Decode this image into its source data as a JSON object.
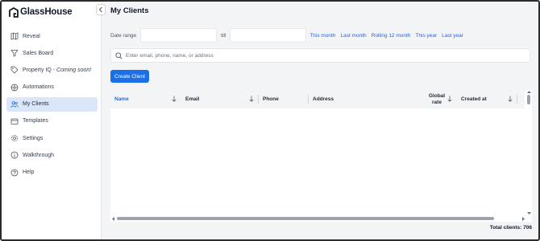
{
  "app": {
    "brand": "GlassHouse"
  },
  "sidebar": {
    "items": [
      {
        "label": "Reveal",
        "icon": "map-icon",
        "active": false
      },
      {
        "label": "Sales Board",
        "icon": "filter-icon",
        "active": false
      },
      {
        "label": "Property IQ - ",
        "suffix": "Coming soon!",
        "icon": "tag-icon",
        "active": false
      },
      {
        "label": "Automations",
        "icon": "automation-icon",
        "active": false
      },
      {
        "label": "My Clients",
        "icon": "users-icon",
        "active": true
      },
      {
        "label": "Templates",
        "icon": "templates-icon",
        "active": false
      },
      {
        "label": "Settings",
        "icon": "gear-icon",
        "active": false
      },
      {
        "label": "Walkthrough",
        "icon": "info-icon",
        "active": false
      },
      {
        "label": "Help",
        "icon": "help-icon",
        "active": false
      }
    ]
  },
  "main": {
    "title": "My Clients",
    "date_range_label": "Date range",
    "till_label": "till",
    "quick_ranges": [
      "This month",
      "Last month",
      "Rolling 12 month",
      "This year",
      "Last year"
    ],
    "search": {
      "placeholder": "Enter email, phone, name, or address",
      "value": ""
    },
    "create_button": "Create Client",
    "table": {
      "columns": [
        {
          "label": "Name",
          "sortable": true,
          "active": true
        },
        {
          "label": "Email",
          "sortable": true,
          "active": false
        },
        {
          "label": "Phone",
          "sortable": false,
          "active": false
        },
        {
          "label": "Address",
          "sortable": false,
          "active": false
        },
        {
          "label": "Global rate",
          "sortable": true,
          "active": false
        },
        {
          "label": "Created at",
          "sortable": true,
          "active": false
        }
      ],
      "rows": []
    },
    "total": "Total clients: 706"
  },
  "colors": {
    "accent": "#1d6fe8",
    "active_nav_bg": "#dbe7f9",
    "link": "#2563eb"
  }
}
